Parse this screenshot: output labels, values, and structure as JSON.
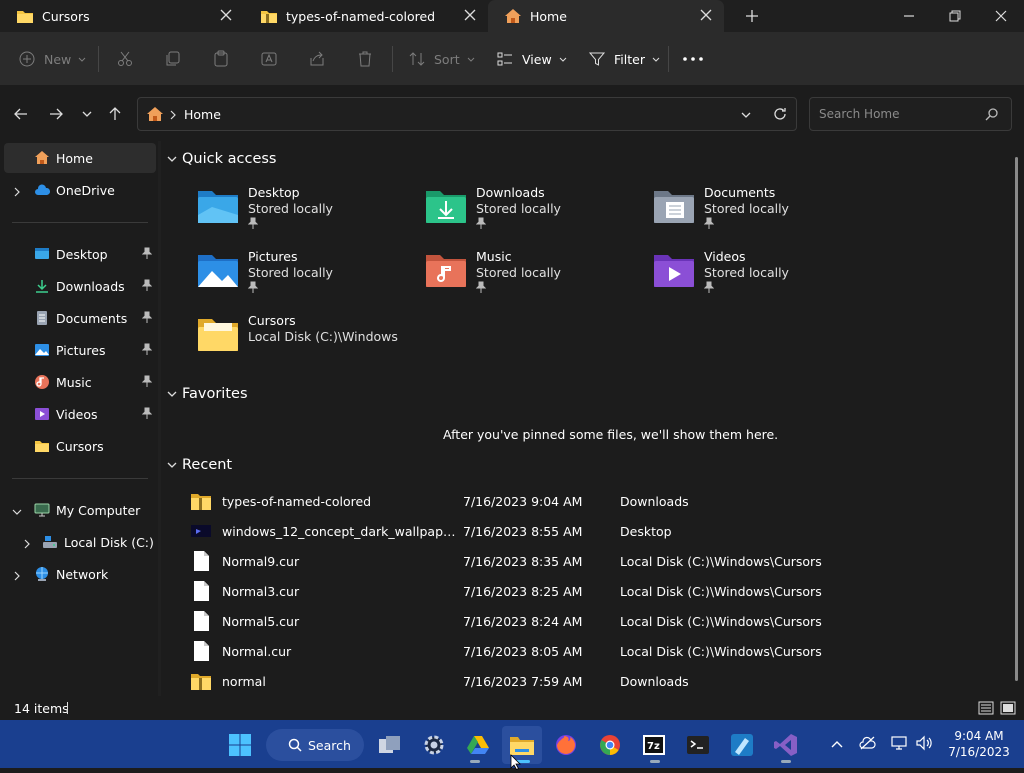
{
  "tabs": [
    {
      "label": "Cursors"
    },
    {
      "label": "types-of-named-colored"
    },
    {
      "label": "Home"
    }
  ],
  "commandbar": {
    "new_label": "New",
    "sort_label": "Sort",
    "view_label": "View",
    "filter_label": "Filter"
  },
  "address": {
    "location": "Home"
  },
  "search": {
    "placeholder": "Search Home"
  },
  "sidebar": {
    "home": "Home",
    "onedrive": "OneDrive",
    "pinned": [
      "Desktop",
      "Downloads",
      "Documents",
      "Pictures",
      "Music",
      "Videos",
      "Cursors"
    ],
    "my_computer": "My Computer",
    "local_disk": "Local Disk (C:)",
    "network": "Network"
  },
  "quick_access": {
    "heading": "Quick access",
    "items": [
      {
        "name": "Desktop",
        "sub": "Stored locally"
      },
      {
        "name": "Downloads",
        "sub": "Stored locally"
      },
      {
        "name": "Documents",
        "sub": "Stored locally"
      },
      {
        "name": "Pictures",
        "sub": "Stored locally"
      },
      {
        "name": "Music",
        "sub": "Stored locally"
      },
      {
        "name": "Videos",
        "sub": "Stored locally"
      },
      {
        "name": "Cursors",
        "sub": "Local Disk (C:)\\Windows"
      }
    ]
  },
  "favorites": {
    "heading": "Favorites",
    "empty_message": "After you've pinned some files, we'll show them here."
  },
  "recent": {
    "heading": "Recent",
    "rows": [
      {
        "name": "types-of-named-colored",
        "date": "7/16/2023 9:04 AM",
        "location": "Downloads"
      },
      {
        "name": "windows_12_concept_dark_wallpaper_b...",
        "date": "7/16/2023 8:55 AM",
        "location": "Desktop"
      },
      {
        "name": "Normal9.cur",
        "date": "7/16/2023 8:35 AM",
        "location": "Local Disk (C:)\\Windows\\Cursors"
      },
      {
        "name": "Normal3.cur",
        "date": "7/16/2023 8:25 AM",
        "location": "Local Disk (C:)\\Windows\\Cursors"
      },
      {
        "name": "Normal5.cur",
        "date": "7/16/2023 8:24 AM",
        "location": "Local Disk (C:)\\Windows\\Cursors"
      },
      {
        "name": "Normal.cur",
        "date": "7/16/2023 8:05 AM",
        "location": "Local Disk (C:)\\Windows\\Cursors"
      },
      {
        "name": "normal",
        "date": "7/16/2023 7:59 AM",
        "location": "Downloads"
      }
    ]
  },
  "status": {
    "items_count": "14 items"
  },
  "taskbar": {
    "search_label": "Search",
    "time": "9:04 AM",
    "date": "7/16/2023"
  },
  "colors": {
    "accent": "#4cc2ff",
    "folder_yellow": "#f4c542",
    "taskbar": "#1a3f8f"
  }
}
